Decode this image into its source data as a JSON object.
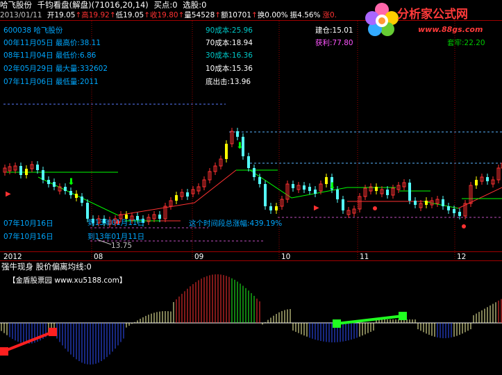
{
  "header": {
    "stock_name": "哈飞股份",
    "indicator_title": "千钧看盘(解盘)",
    "indicator_params": "(71016,20,14)",
    "buy_point": "买点:0",
    "select": "选股:0"
  },
  "quote": {
    "date": "2013/01/11",
    "open": "开19.05",
    "high": "高19.92",
    "low": "低19.05",
    "close": "收19.80",
    "volume": "量54528",
    "amount": "额10701",
    "turnover": "换0.00%",
    "amplitude": "振4.56%",
    "change": "涨0.",
    "arrow_up": "↑"
  },
  "info": {
    "code_name": "600038 哈飞股份",
    "high_price": "00年11月05日 最高价:38.11",
    "low_price": "08年11月04日 最低价:6.86",
    "max_volume": "02年05月29日 最大量:332602",
    "min_volume": "07年11月06日 最低量:2011"
  },
  "cost": {
    "c90": "90成本:25.96",
    "c70": "70成本:18.94",
    "c30": "30成本:16.36",
    "c10": "10成本:15.36",
    "bottom": "底出击:13.96"
  },
  "position": {
    "build": "建仓:15.01",
    "profit": "获利:77.80",
    "trapped": "套牢:22.20"
  },
  "annotations": {
    "left_date_1": "07年10月16日",
    "left_date_2": "07年10月16日",
    "to_date_1": "到13年01月11日",
    "to_date_2": "到13年01月11日",
    "period_change": "这个时间段总涨幅:439.19%",
    "low_marker": "13.75"
  },
  "time_axis": [
    "2012",
    "08",
    "09",
    "10",
    "11",
    "12"
  ],
  "oscillator": {
    "title": "强牛现身 股价偏离均线:0",
    "watermark_text": "【金盾股票园 www.xu5188.com】"
  },
  "watermark": {
    "title": "分析家公式网",
    "url": "www.88gs.com"
  },
  "colors": {
    "background": "#000000",
    "up": "#ff3232",
    "down": "#54fcfc",
    "yellow": "#ffff00",
    "cyan_text": "#00a8ff",
    "green": "#00ff00",
    "magenta": "#ff54ff"
  }
}
